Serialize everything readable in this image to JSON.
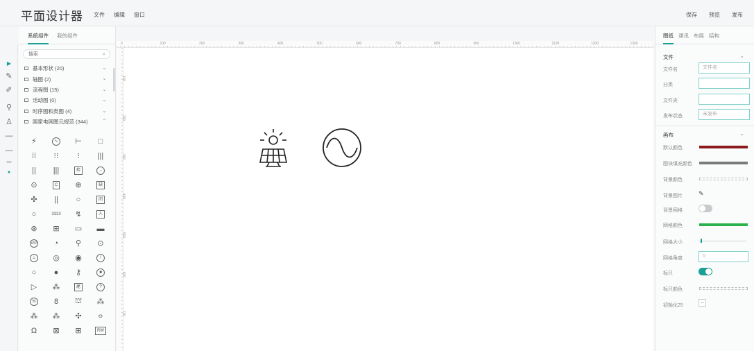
{
  "app": {
    "title": "平面设计器"
  },
  "menu": [
    "文件",
    "编辑",
    "窗口"
  ],
  "actions": [
    "保存",
    "预览",
    "发布"
  ],
  "left_panel": {
    "tabs": [
      {
        "label": "系统组件",
        "active": true
      },
      {
        "label": "我的组件",
        "active": false
      }
    ],
    "search_placeholder": "搜索",
    "categories": [
      {
        "label": "基本形状 (20)",
        "chevron": "chevron-down-icon"
      },
      {
        "label": "轴图 (2)",
        "chevron": "chevron-down-icon"
      },
      {
        "label": "流程图 (15)",
        "chevron": "chevron-down-icon"
      },
      {
        "label": "活动图 (0)",
        "chevron": "chevron-down-icon"
      },
      {
        "label": "时序图和类图 (4)",
        "chevron": "chevron-down-icon"
      },
      {
        "label": "国家电网图元规范 (344)",
        "chevron": "chevron-up-icon"
      }
    ],
    "grid_items": [
      {
        "icon": "substation-icon",
        "glyph": "⚡",
        "text": ""
      },
      {
        "icon": "ac-source-icon",
        "glyph": "∿",
        "text": "",
        "circle": true
      },
      {
        "icon": "ground-line-icon",
        "glyph": "⊢",
        "text": ""
      },
      {
        "icon": "square-icon",
        "glyph": "□",
        "text": ""
      },
      {
        "icon": "battery-bank-icon",
        "glyph": "⁞⁞",
        "text": ""
      },
      {
        "icon": "battery-pair-icon",
        "glyph": "⁝⁝",
        "text": ""
      },
      {
        "icon": "battery-single-icon",
        "glyph": "⁝",
        "text": ""
      },
      {
        "icon": "triple-bar-icon",
        "glyph": "|||",
        "text": ""
      },
      {
        "icon": "double-bar-icon",
        "glyph": "||",
        "text": ""
      },
      {
        "icon": "triple-bar-2-icon",
        "glyph": "|||",
        "text": ""
      },
      {
        "icon": "inspect-box-icon",
        "glyph": "",
        "text": "检",
        "square": true
      },
      {
        "icon": "arrow-circle-icon",
        "glyph": "→",
        "text": "",
        "circle": true
      },
      {
        "icon": "meter-icon",
        "glyph": "⊙",
        "text": ""
      },
      {
        "icon": "capacitor-box-icon",
        "glyph": "",
        "text": "C",
        "square": true
      },
      {
        "icon": "plus-circle-icon",
        "glyph": "⊕",
        "text": ""
      },
      {
        "icon": "defect-box-icon",
        "glyph": "",
        "text": "缺",
        "square": true
      },
      {
        "icon": "fan-icon",
        "glyph": "✣",
        "text": ""
      },
      {
        "icon": "double-line-icon",
        "glyph": "||",
        "text": ""
      },
      {
        "icon": "circle-icon",
        "glyph": "○",
        "text": ""
      },
      {
        "icon": "closed-box-icon",
        "glyph": "",
        "text": "闭",
        "square": true
      },
      {
        "icon": "empty-circle-icon",
        "glyph": "○",
        "text": ""
      },
      {
        "icon": "number-3333-icon",
        "glyph": "",
        "text": "3333"
      },
      {
        "icon": "lightning-icon",
        "glyph": "↯",
        "text": ""
      },
      {
        "icon": "person-box-icon",
        "glyph": "",
        "text": "人",
        "square": true
      },
      {
        "icon": "switch-circle-icon",
        "glyph": "⊛",
        "text": ""
      },
      {
        "icon": "grid-box-icon",
        "glyph": "⊞",
        "text": ""
      },
      {
        "icon": "panel-bar-icon",
        "glyph": "▭",
        "text": ""
      },
      {
        "icon": "dash-bar-icon",
        "glyph": "▬",
        "text": ""
      },
      {
        "icon": "vip-icon",
        "glyph": "",
        "text": "VIP",
        "circle": true
      },
      {
        "icon": "drop-icon",
        "glyph": "◔",
        "text": ""
      },
      {
        "icon": "plug-icon",
        "glyph": "⚲",
        "text": ""
      },
      {
        "icon": "tri-dot-circle-icon",
        "glyph": "⊙",
        "text": ""
      },
      {
        "icon": "ground-circle-icon",
        "glyph": "⊥",
        "text": "",
        "circle": true
      },
      {
        "icon": "transformer-circle-icon",
        "glyph": "◎",
        "text": ""
      },
      {
        "icon": "target-circle-icon",
        "glyph": "◉",
        "text": ""
      },
      {
        "icon": "alert-circle-icon",
        "glyph": "!",
        "text": "",
        "circle": true
      },
      {
        "icon": "empty-ring-icon",
        "glyph": "○",
        "text": ""
      },
      {
        "icon": "filled-circle-icon",
        "glyph": "●",
        "text": ""
      },
      {
        "icon": "key-icon",
        "glyph": "⚷",
        "text": ""
      },
      {
        "icon": "stop-circle-icon",
        "glyph": "■",
        "text": "",
        "circle": true
      },
      {
        "icon": "triangle-flow-icon",
        "glyph": "▷",
        "text": ""
      },
      {
        "icon": "triple-circle-icon",
        "glyph": "⁂",
        "text": ""
      },
      {
        "icon": "tail-box-icon",
        "glyph": "",
        "text": "尾",
        "square": true
      },
      {
        "icon": "question-circle-icon",
        "glyph": "?",
        "text": "",
        "circle": true
      },
      {
        "icon": "percent-circle-icon",
        "glyph": "%",
        "text": "",
        "circle": true
      },
      {
        "icon": "double-circle-icon",
        "glyph": "8",
        "text": ""
      },
      {
        "icon": "tower-icon",
        "glyph": "⛫",
        "text": ""
      },
      {
        "icon": "cluster-icon",
        "glyph": "⁂",
        "text": ""
      },
      {
        "icon": "triple-ring-icon",
        "glyph": "⁂",
        "text": ""
      },
      {
        "icon": "triple-ring-2-icon",
        "glyph": "⁂",
        "text": ""
      },
      {
        "icon": "fan-2-icon",
        "glyph": "✣",
        "text": ""
      },
      {
        "icon": "capsule-icon",
        "glyph": "⦵",
        "text": ""
      },
      {
        "icon": "omega-icon",
        "glyph": "Ω",
        "text": ""
      },
      {
        "icon": "cross-box-icon",
        "glyph": "⊠",
        "text": ""
      },
      {
        "icon": "ladder-icon",
        "glyph": "⊞",
        "text": ""
      },
      {
        "icon": "resistor-box-icon",
        "glyph": "",
        "text": "RW",
        "square": true
      }
    ]
  },
  "ruler": {
    "h_labels": [
      "0",
      "100",
      "200",
      "300",
      "400",
      "500",
      "600",
      "700",
      "800",
      "900",
      "1000",
      "1100",
      "1200",
      "1300"
    ],
    "v_labels": [
      "0",
      "100",
      "200",
      "300",
      "400",
      "500",
      "600",
      "700"
    ]
  },
  "canvas": {
    "items": [
      {
        "icon": "solar-panel-icon"
      },
      {
        "icon": "ac-source-icon"
      }
    ]
  },
  "right_panel": {
    "tabs": [
      {
        "label": "图纸",
        "active": true
      },
      {
        "label": "通讯",
        "active": false
      },
      {
        "label": "布局",
        "active": false
      },
      {
        "label": "结构",
        "active": false
      }
    ],
    "file_section": {
      "title": "文件",
      "rows": [
        {
          "label": "文件名",
          "placeholder": "文件名"
        },
        {
          "label": "分类",
          "placeholder": ""
        },
        {
          "label": "文件夹",
          "placeholder": ""
        },
        {
          "label": "发布状态",
          "placeholder": "未发布"
        }
      ]
    },
    "canvas_section": {
      "title": "画布",
      "default_color_label": "默认颜色",
      "default_color": "#8b1a1a",
      "fill_color_label": "图块填充颜色",
      "fill_color": "#7a7a7a",
      "bg_color_label": "背景颜色",
      "bg_image_label": "背景图片",
      "bg_grid_label": "背景网格",
      "bg_grid_on": false,
      "grid_color_label": "网格颜色",
      "grid_color": "#2bb24c",
      "grid_size_label": "网格大小",
      "grid_size_fraction": 0.04,
      "grid_angle_label": "网格角度",
      "grid_angle_value": "0",
      "ruler_label": "标尺",
      "ruler_on": true,
      "ruler_color_label": "标尺颜色",
      "init_label": "初始化25"
    }
  }
}
